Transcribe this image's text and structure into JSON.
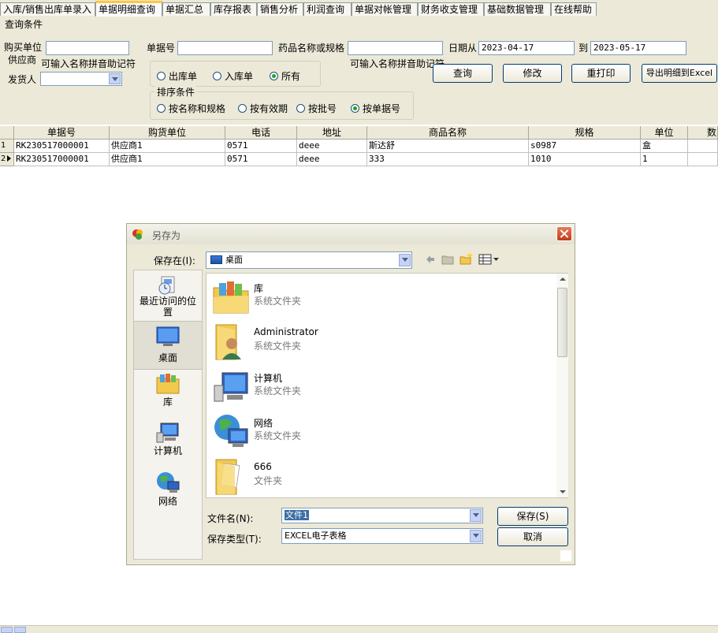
{
  "tabs": [
    {
      "label": "入库/销售出库单录入",
      "active": false
    },
    {
      "label": "单据明细查询",
      "active": true
    },
    {
      "label": "单据汇总",
      "active": false
    },
    {
      "label": "库存报表",
      "active": false
    },
    {
      "label": "销售分析",
      "active": false
    },
    {
      "label": "利润查询",
      "active": false
    },
    {
      "label": "单据对帐管理",
      "active": false
    },
    {
      "label": "财务收支管理",
      "active": false
    },
    {
      "label": "基础数据管理",
      "active": false
    },
    {
      "label": "在线帮助",
      "active": false
    }
  ],
  "query": {
    "section_title": "查询条件",
    "buyer_label": "购买单位",
    "supplier_label": "供应商",
    "pinyin_hint": "可输入名称拼音助记符",
    "shipper_label": "发货人",
    "doc_no_label": "单据号",
    "drug_label": "药品名称或规格",
    "pinyin_hint2": "可输入名称拼音助记符",
    "date_from_label": "日期从",
    "date_from": "2023-04-17",
    "to_label": "到",
    "date_to": "2023-05-17",
    "type_options": [
      {
        "label": "出库单",
        "checked": false
      },
      {
        "label": "入库单",
        "checked": false
      },
      {
        "label": "所有",
        "checked": true
      }
    ],
    "sort_title": "排序条件",
    "sort_options": [
      {
        "label": "按名称和规格",
        "checked": false
      },
      {
        "label": "按有效期",
        "checked": false
      },
      {
        "label": "按批号",
        "checked": false
      },
      {
        "label": "按单据号",
        "checked": true
      }
    ],
    "buttons": {
      "query": "查询",
      "modify": "修改",
      "reprint": "重打印",
      "export": "导出明细到Excel"
    }
  },
  "grid": {
    "columns": [
      "单据号",
      "购货单位",
      "电话",
      "地址",
      "商品名称",
      "规格",
      "单位",
      "数"
    ],
    "rows": [
      {
        "num": "1",
        "cells": [
          "RK230517000001",
          "供应商1",
          "0571",
          "deee",
          "斯达舒",
          "s0987",
          "盒",
          ""
        ]
      },
      {
        "num": "2",
        "cells": [
          "RK230517000001",
          "供应商1",
          "0571",
          "deee",
          "333",
          "1010",
          "1",
          ""
        ]
      }
    ]
  },
  "dialog": {
    "title": "另存为",
    "save_in_label": "保存在(I):",
    "save_in_value": "桌面",
    "places": [
      "最近访问的位置",
      "桌面",
      "库",
      "计算机",
      "网络"
    ],
    "files": [
      {
        "name": "库",
        "desc": "系统文件夹",
        "icon": "library-folder-icon"
      },
      {
        "name": "Administrator",
        "desc": "系统文件夹",
        "icon": "user-folder-icon"
      },
      {
        "name": "计算机",
        "desc": "系统文件夹",
        "icon": "computer-icon"
      },
      {
        "name": "网络",
        "desc": "系统文件夹",
        "icon": "network-icon"
      },
      {
        "name": "666",
        "desc": "文件夹",
        "icon": "folder-icon"
      }
    ],
    "filename_label": "文件名(N):",
    "filename_value": "文件1",
    "filetype_label": "保存类型(T):",
    "filetype_value": "EXCEL电子表格",
    "save_button": "保存(S)",
    "cancel_button": "取消"
  }
}
